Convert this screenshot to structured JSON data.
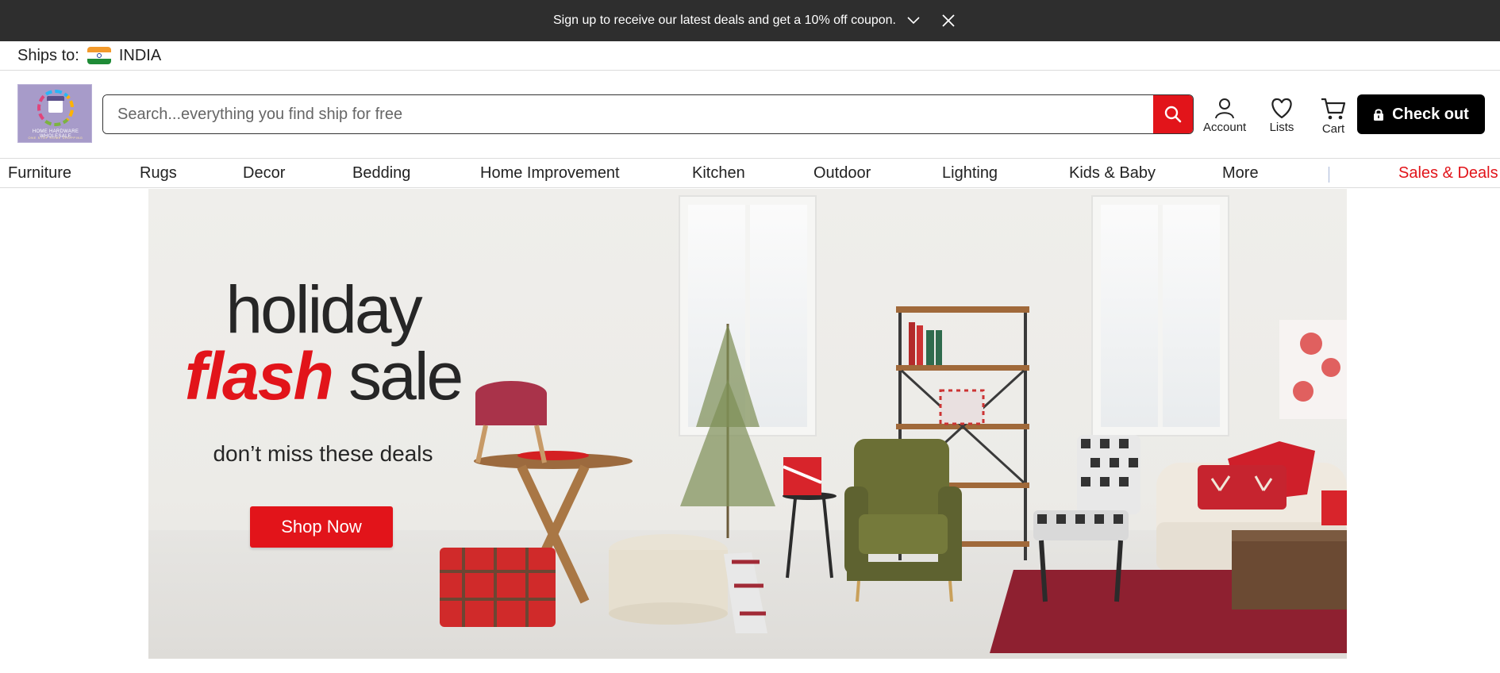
{
  "promo": {
    "text": "Sign up to receive our latest deals and get a 10% off coupon."
  },
  "ships": {
    "label": "Ships to:",
    "country": "INDIA"
  },
  "logo": {
    "line1": "HOME HARDWARE WHOLESALE",
    "line2": "ONE STOP HOME SHOPPING"
  },
  "search": {
    "placeholder": "Search...everything you find ship for free"
  },
  "header": {
    "account_label": "Account",
    "lists_label": "Lists",
    "cart_label": "Cart",
    "checkout_label": "Check out"
  },
  "nav": {
    "items": [
      "Furniture",
      "Rugs",
      "Decor",
      "Bedding",
      "Home Improvement",
      "Kitchen",
      "Outdoor",
      "Lighting",
      "Kids & Baby",
      "More"
    ],
    "deals": "Sales & Deals"
  },
  "hero": {
    "line1": "holiday",
    "line2_accent": "flash",
    "line2_rest": "sale",
    "subtitle": "don’t miss these deals",
    "cta": "Shop Now"
  },
  "colors": {
    "accent_red": "#e2141a",
    "promo_bg": "#2e2e2e",
    "checkout_bg": "#000000"
  }
}
